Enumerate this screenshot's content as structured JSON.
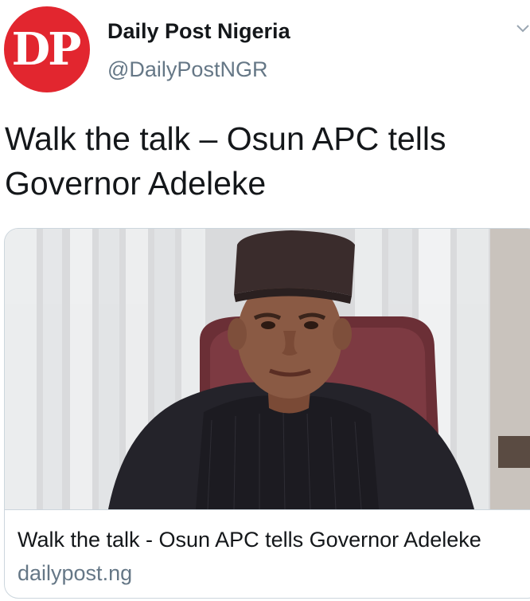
{
  "account": {
    "avatar_text": "DP",
    "display_name": "Daily Post Nigeria",
    "handle": "@DailyPostNGR"
  },
  "tweet": {
    "text": "Walk the talk – Osun APC tells Governor Adeleke"
  },
  "card": {
    "image_icon": "news-photo",
    "title": "Walk the talk - Osun APC tells Governor Adeleke",
    "domain": "dailypost.ng"
  },
  "icons": {
    "menu": "chevron-down-icon"
  },
  "colors": {
    "brand_red": "#e2262f",
    "text": "#14171a",
    "secondary": "#657786",
    "border": "#ccd6dd"
  }
}
